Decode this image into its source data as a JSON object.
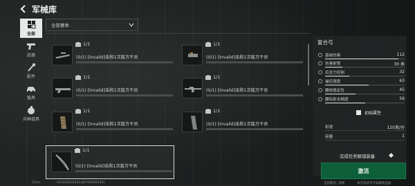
{
  "header": {
    "title": "军械库"
  },
  "sidebar": {
    "items": [
      {
        "label": "全部",
        "icon": "grid-icon",
        "active": true
      },
      {
        "label": "武器",
        "icon": "pistol-icon",
        "active": false
      },
      {
        "label": "配件",
        "icon": "wrench-icon",
        "active": false
      },
      {
        "label": "载具",
        "icon": "vehicle-icon",
        "active": false
      },
      {
        "label": "兵种道具",
        "icon": "grenade-icon",
        "active": false
      }
    ]
  },
  "season_filter": {
    "selected": "全部赛季"
  },
  "items": [
    {
      "count": "1/1",
      "description": "(0/1) [Invalid]击败1次敌方干员",
      "icon": "sniper-rifle-icon",
      "selected": false
    },
    {
      "count": "1/1",
      "description": "(0/1) [Invalid]击败1次敌方干员",
      "icon": "scope-attachment-icon",
      "selected": false
    },
    {
      "count": "1/1",
      "description": "(0/1) [Invalid]击败1次敌方干员",
      "icon": "shotgun-icon",
      "selected": false
    },
    {
      "count": "1/1",
      "description": "(0/1) [Invalid]击败1次敌方干员",
      "icon": "assault-rifle-icon",
      "selected": false
    },
    {
      "count": "1/1",
      "description": "(0/1) [Invalid]击败1次敌方干员",
      "icon": "grip-attachment-icon",
      "selected": false
    },
    {
      "count": "1/1",
      "description": "(0/1) [Invalid]击败1次敌方干员",
      "icon": "magazine-icon",
      "selected": false
    },
    {
      "count": "1/1",
      "description": "(0/1) [Invalid]击败1次敌方干员",
      "icon": "compound-bow-icon",
      "selected": true
    }
  ],
  "detail": {
    "name": "复合弓",
    "stats": [
      {
        "label": "基础伤害",
        "value": "112",
        "fill": 0.92
      },
      {
        "label": "伤害射程",
        "value": "30 米",
        "fill": 0.22
      },
      {
        "label": "后坐力控制",
        "value": "32",
        "fill": 0.3
      },
      {
        "label": "操控速度",
        "value": "63",
        "fill": 0.55
      },
      {
        "label": "腰枪稳定性",
        "value": "45",
        "fill": 0.38
      },
      {
        "label": "腰际射击精度",
        "value": "59",
        "fill": 0.5
      }
    ],
    "initial_attributes_label": "初始属性",
    "extra_stats": [
      {
        "label": "射速",
        "value": "120发/分"
      },
      {
        "label": "容量",
        "value": "1"
      }
    ],
    "unlock_text": "完成任务解锁装备",
    "activate_label": "激活"
  },
  "footer": {
    "left": "52ms",
    "uid": "UE4|G84|0|2814|87648484391",
    "right1": "当前服务: 流畅",
    "right2": "本次测试不代表最终品质"
  },
  "colors": {
    "accent_green": "#0d5f3a",
    "panel": "#232625"
  }
}
